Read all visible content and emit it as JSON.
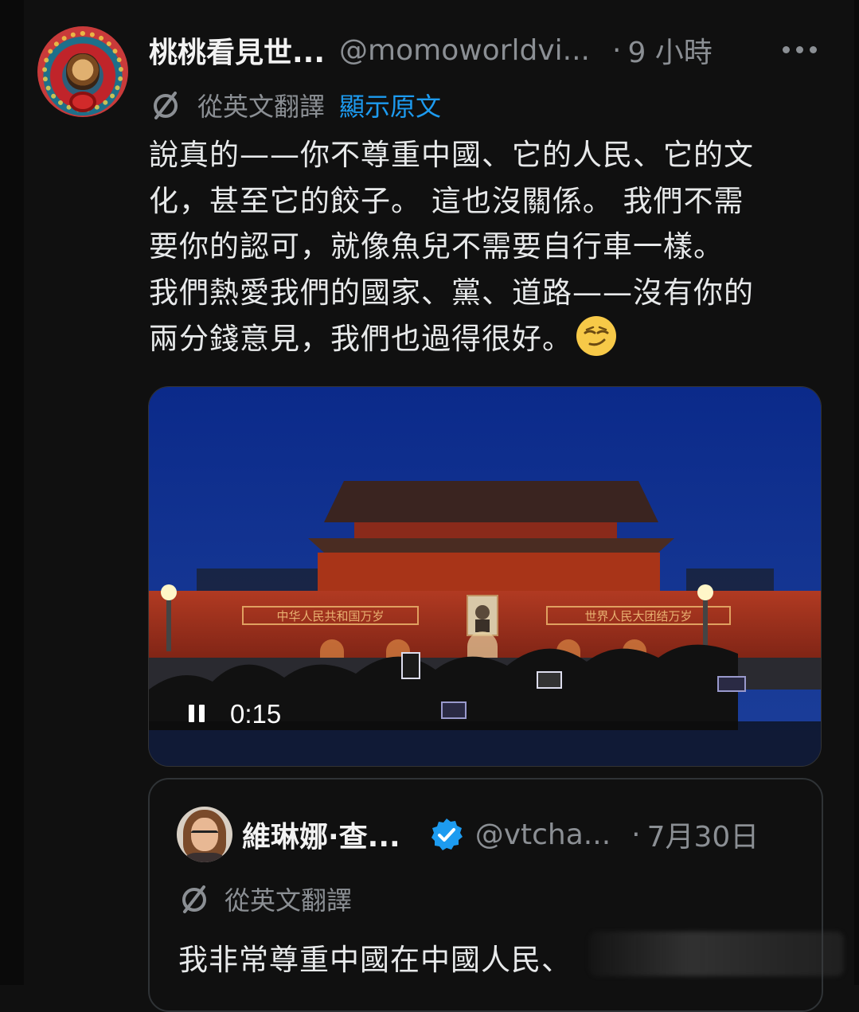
{
  "post": {
    "display_name": "桃桃看見世...",
    "handle": "@momoworldvi...",
    "separator": "·",
    "time": "9 小時",
    "more_icon": "more-horizontal-icon",
    "translation_label": "從英文翻譯",
    "show_original": "顯示原文",
    "body_lines": [
      "說真的——你不尊重中國、它的人民、它的文",
      "化，甚至它的餃子。 這也沒關係。 我們不需",
      "要你的認可，就像魚兒不需要自行車一樣。",
      "我們熱愛我們的國家、黨、道路——沒有你的",
      "兩分錢意見，我們也過得很好。"
    ],
    "emoji": "smirking-face-icon"
  },
  "video": {
    "time": "0:15",
    "control_icon": "pause-icon",
    "banner_left": "中华人民共和国万岁",
    "banner_right": "世界人民大团结万岁"
  },
  "quote": {
    "display_name": "維琳娜·查...",
    "verified_icon": "verified-badge-icon",
    "handle": "@vtcha...",
    "separator": "·",
    "date": "7月30日",
    "translation_label": "從英文翻譯",
    "body": "我非常尊重中國在中國人民、"
  },
  "colors": {
    "background": "#101010",
    "link": "#1d9bf0",
    "secondary_text": "#8b8f94",
    "verified": "#1d9bf0"
  }
}
